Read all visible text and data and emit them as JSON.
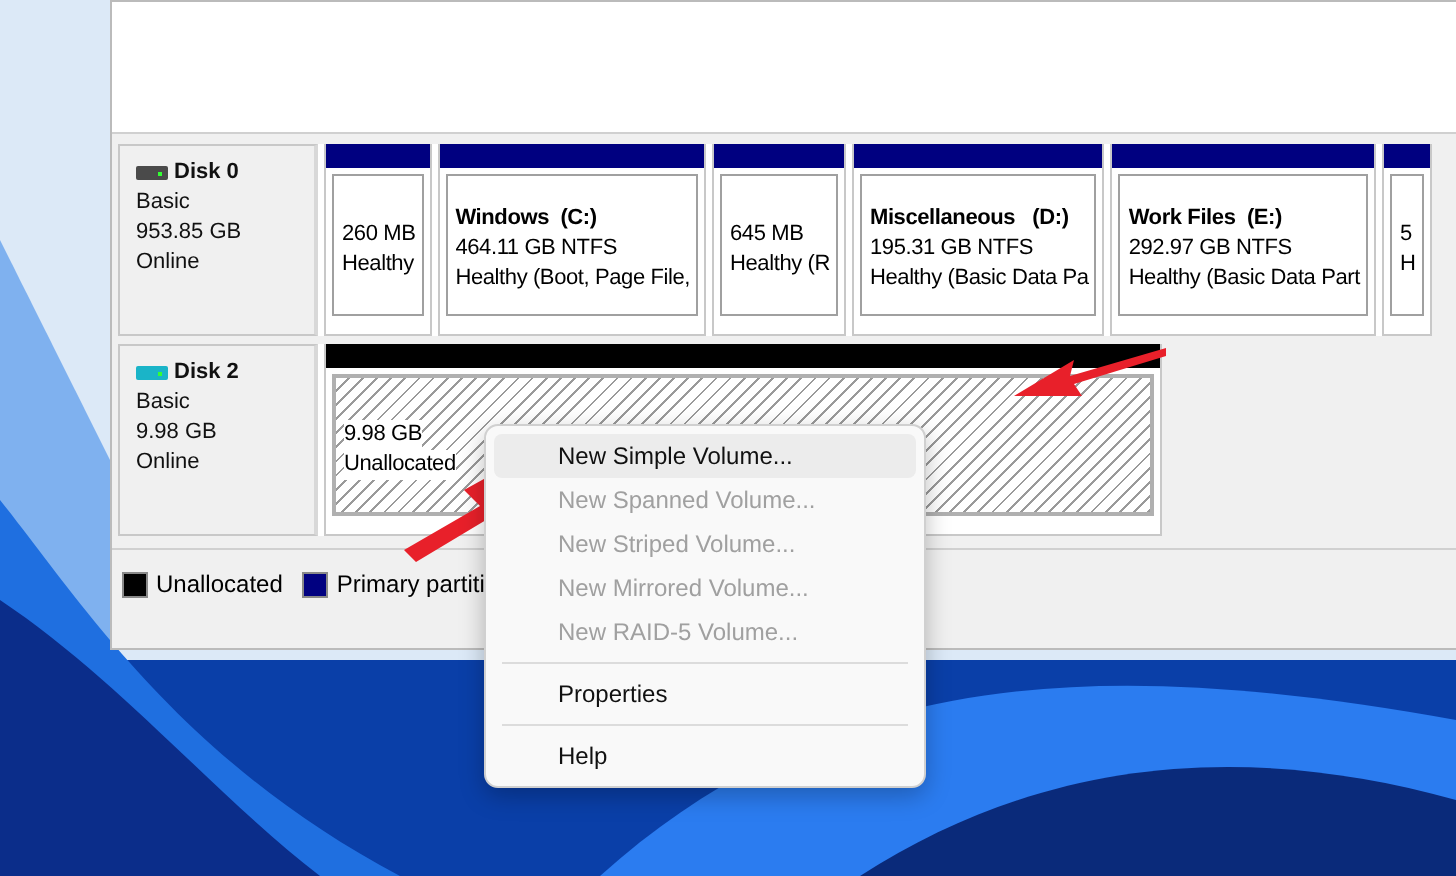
{
  "disks": [
    {
      "name": "Disk 0",
      "type": "Basic",
      "size": "953.85 GB",
      "status": "Online",
      "color": "#4a4a4a",
      "partitions": [
        {
          "kind": "primary",
          "size": "260 MB",
          "status": "Healthy"
        },
        {
          "kind": "primary",
          "label": "Windows  (C:)",
          "size": "464.11 GB NTFS",
          "status": "Healthy (Boot, Page File,"
        },
        {
          "kind": "primary",
          "size": "645 MB",
          "status": "Healthy (R"
        },
        {
          "kind": "primary",
          "label": "Miscellaneous   (D:)",
          "size": "195.31 GB NTFS",
          "status": "Healthy (Basic Data Pa"
        },
        {
          "kind": "primary",
          "label": "Work Files  (E:)",
          "size": "292.97 GB NTFS",
          "status": "Healthy (Basic Data Part"
        },
        {
          "kind": "primary",
          "size": "5",
          "status": "H"
        }
      ]
    },
    {
      "name": "Disk 2",
      "type": "Basic",
      "size": "9.98 GB",
      "status": "Online",
      "color": "#1ab4c8",
      "partitions": [
        {
          "kind": "unallocated",
          "size": "9.98 GB",
          "status": "Unallocated"
        }
      ]
    }
  ],
  "legend": [
    {
      "label": "Unallocated",
      "color": "#000000"
    },
    {
      "label": "Primary partiti",
      "color": "#000080"
    }
  ],
  "context_menu": {
    "items": [
      {
        "kind": "item",
        "label": "New Simple Volume...",
        "disabled": false,
        "selected": true
      },
      {
        "kind": "item",
        "label": "New Spanned Volume...",
        "disabled": true,
        "selected": false
      },
      {
        "kind": "item",
        "label": "New Striped Volume...",
        "disabled": true,
        "selected": false
      },
      {
        "kind": "item",
        "label": "New Mirrored Volume...",
        "disabled": true,
        "selected": false
      },
      {
        "kind": "item",
        "label": "New RAID-5 Volume...",
        "disabled": true,
        "selected": false
      },
      {
        "kind": "separator"
      },
      {
        "kind": "item",
        "label": "Properties",
        "disabled": false,
        "selected": false
      },
      {
        "kind": "separator"
      },
      {
        "kind": "item",
        "label": "Help",
        "disabled": false,
        "selected": false
      }
    ]
  }
}
